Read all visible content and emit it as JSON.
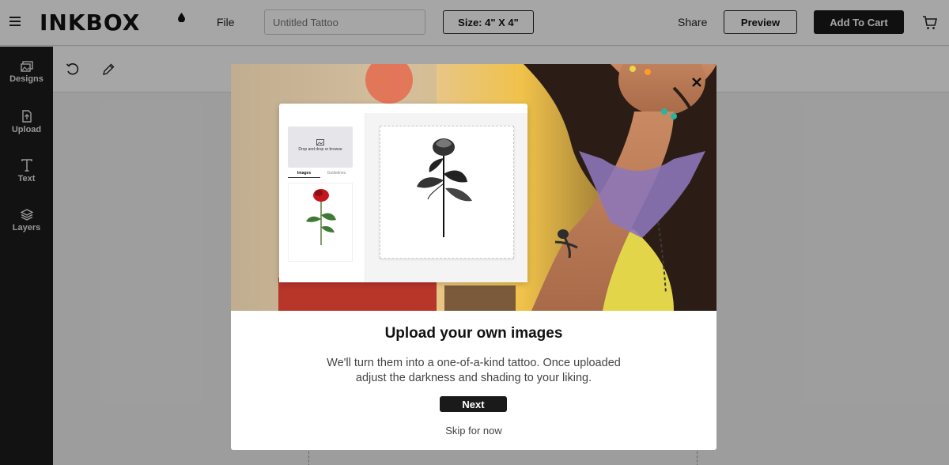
{
  "brand": {
    "logo": "INKBOX"
  },
  "header": {
    "file_label": "File",
    "title_placeholder": "Untitled Tattoo",
    "title_value": "",
    "size_label": "Size: 4\" X 4\"",
    "share_label": "Share",
    "preview_label": "Preview",
    "cart_label": "Add To Cart",
    "icons": {
      "menu": "hamburger-icon",
      "cart": "cart-icon"
    }
  },
  "sidebar": {
    "items": [
      {
        "label": "Designs",
        "icon": "images-icon"
      },
      {
        "label": "Upload",
        "icon": "file-upload-icon"
      },
      {
        "label": "Text",
        "icon": "text-icon"
      },
      {
        "label": "Layers",
        "icon": "layers-icon"
      }
    ]
  },
  "toolbar": {
    "icons": [
      "undo-icon",
      "pencil-icon"
    ]
  },
  "modal": {
    "title": "Upload your own images",
    "description": "We'll turn them into a one-of-a-kind tattoo. Once uploaded adjust the darkness and shading to your liking.",
    "next_label": "Next",
    "skip_label": "Skip for now",
    "mock": {
      "drop_text": "Drop and drop or browse",
      "tab_images": "Images",
      "tab_guidelines": "Guidelines"
    }
  },
  "colors": {
    "accent": "#1a1a1a",
    "sidebar": "#1c1c1c",
    "overlay": "rgba(0,0,0,0.35)"
  }
}
